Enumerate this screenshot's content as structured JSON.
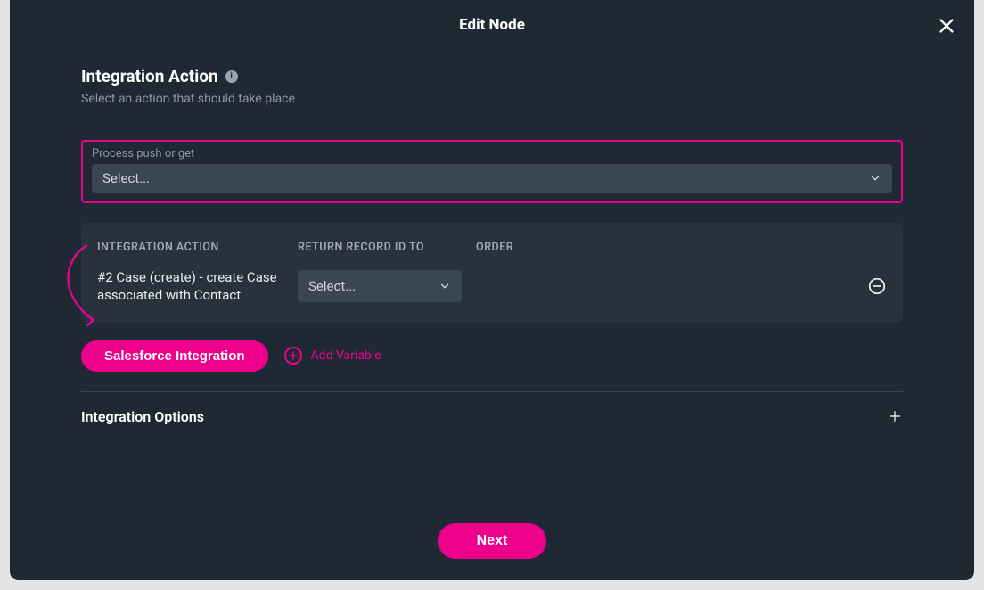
{
  "header": {
    "title": "Edit Node"
  },
  "section": {
    "title": "Integration Action",
    "info_glyph": "i",
    "subtitle": "Select an action that should take place"
  },
  "process": {
    "label": "Process push or get",
    "placeholder": "Select..."
  },
  "table": {
    "headers": {
      "action": "INTEGRATION ACTION",
      "return_to": "RETURN RECORD ID TO",
      "order": "ORDER"
    },
    "row": {
      "action_text": "#2 Case (create) - create Case associated with Contact",
      "return_placeholder": "Select..."
    }
  },
  "pills": {
    "salesforce": "Salesforce Integration",
    "add_variable": "Add Variable"
  },
  "options": {
    "title": "Integration Options"
  },
  "footer": {
    "next": "Next"
  }
}
